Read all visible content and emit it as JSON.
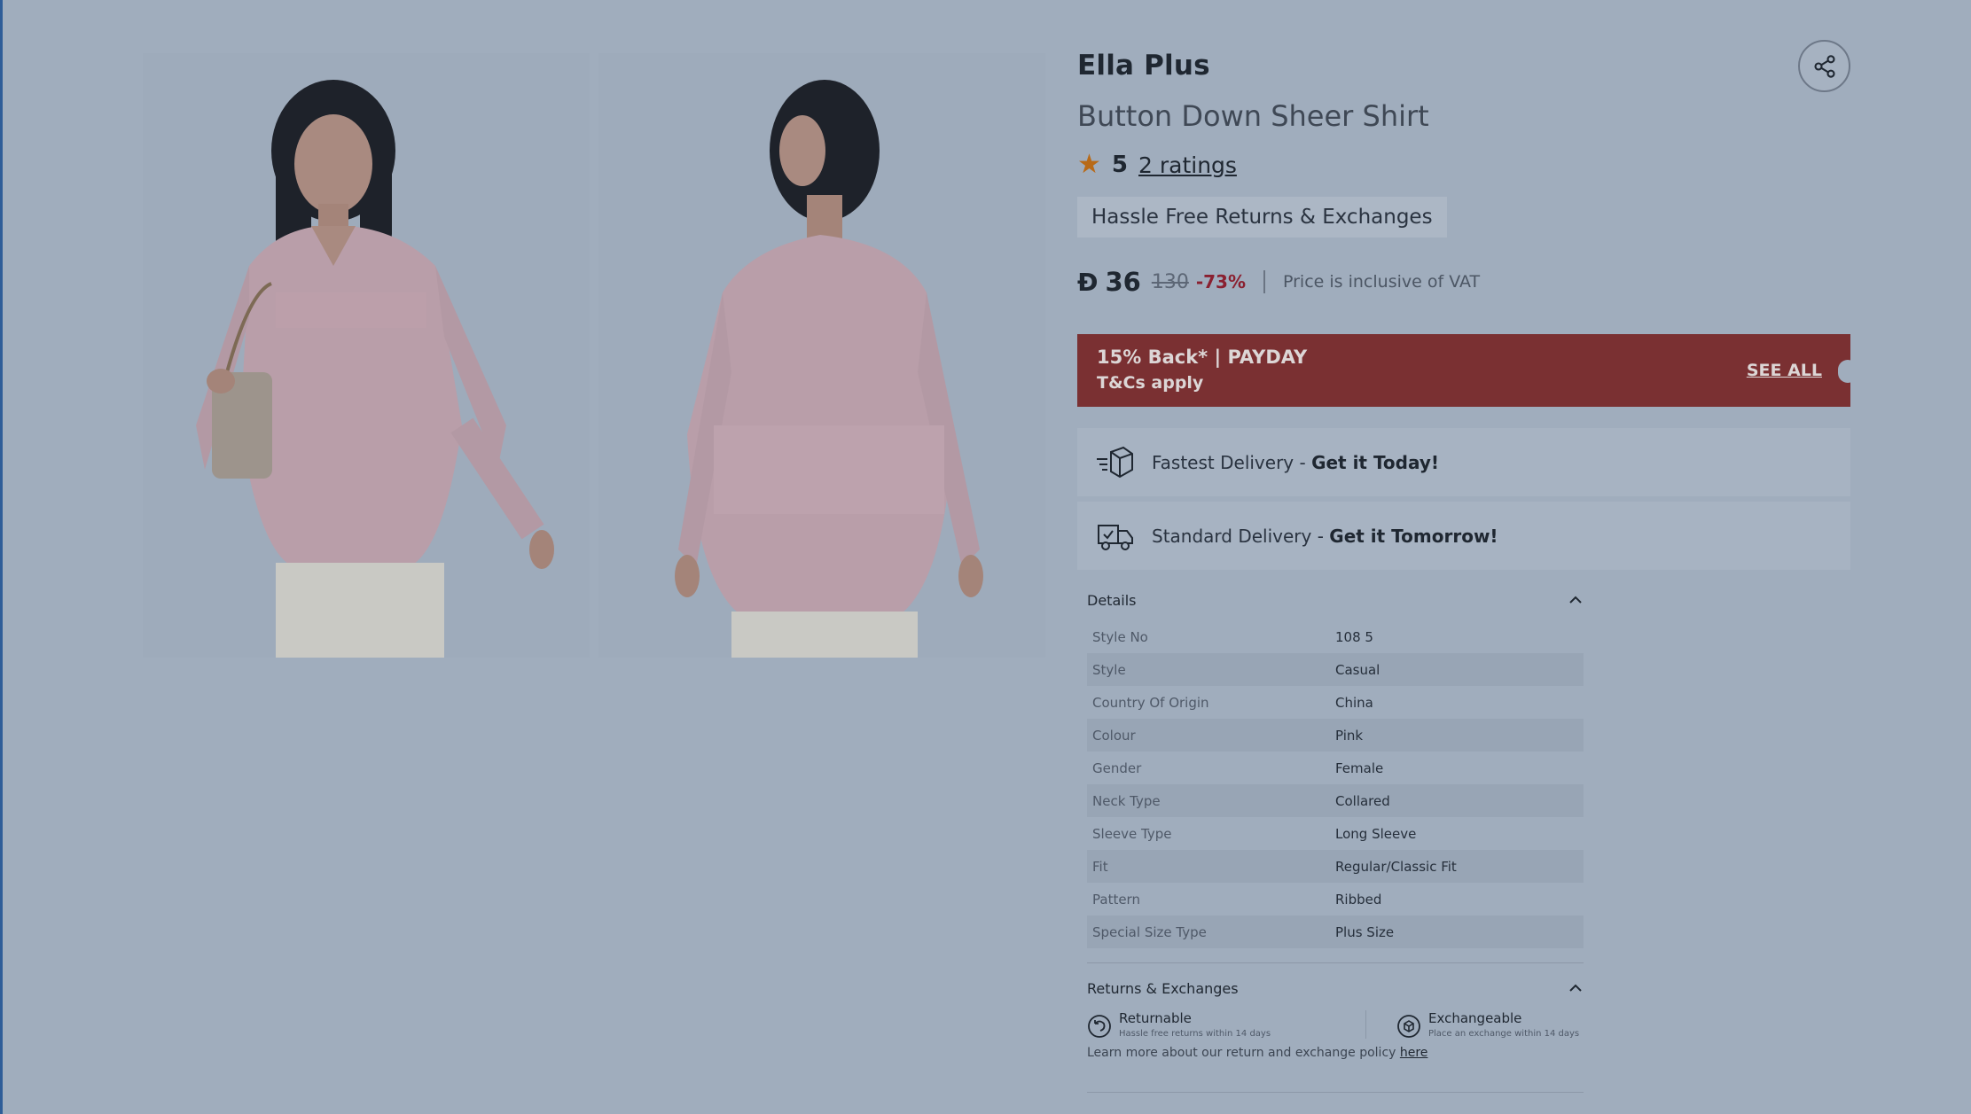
{
  "product": {
    "brand": "Ella Plus",
    "name": "Button Down Sheer Shirt",
    "rating_value": "5",
    "ratings_link": "2 ratings",
    "returns_badge": "Hassle Free Returns & Exchanges",
    "currency_symbol": "Ð",
    "price": "36",
    "old_price": "130",
    "discount": "-73%",
    "vat_note": "Price is inclusive of VAT"
  },
  "promo": {
    "title": "15% Back* | PAYDAY",
    "subtitle": "T&Cs apply",
    "see_all": "SEE ALL"
  },
  "delivery": [
    {
      "label": "Fastest Delivery - ",
      "highlight": "Get it Today!",
      "icon": "fast-box-icon"
    },
    {
      "label": "Standard Delivery - ",
      "highlight": "Get it Tomorrow!",
      "icon": "truck-icon"
    }
  ],
  "details": {
    "heading": "Details",
    "rows": [
      {
        "label": "Style No",
        "value": "108 5"
      },
      {
        "label": "Style",
        "value": "Casual"
      },
      {
        "label": "Country Of Origin",
        "value": "China"
      },
      {
        "label": "Colour",
        "value": "Pink"
      },
      {
        "label": "Gender",
        "value": "Female"
      },
      {
        "label": "Neck Type",
        "value": "Collared"
      },
      {
        "label": "Sleeve Type",
        "value": "Long Sleeve"
      },
      {
        "label": "Fit",
        "value": "Regular/Classic Fit"
      },
      {
        "label": "Pattern",
        "value": "Ribbed"
      },
      {
        "label": "Special Size Type",
        "value": "Plus Size"
      }
    ]
  },
  "returns": {
    "heading": "Returns & Exchanges",
    "returnable_title": "Returnable",
    "returnable_sub": "Hassle free returns within 14 days",
    "exchangeable_title": "Exchangeable",
    "exchangeable_sub": "Place an exchange within 14 days",
    "note": "Learn more about our return and exchange policy ",
    "note_link": "here"
  },
  "colors": {
    "overlay_bg": "#a0adbd",
    "promo_bg": "#7a3032",
    "star": "#b86a18",
    "discount": "#8a2030"
  }
}
